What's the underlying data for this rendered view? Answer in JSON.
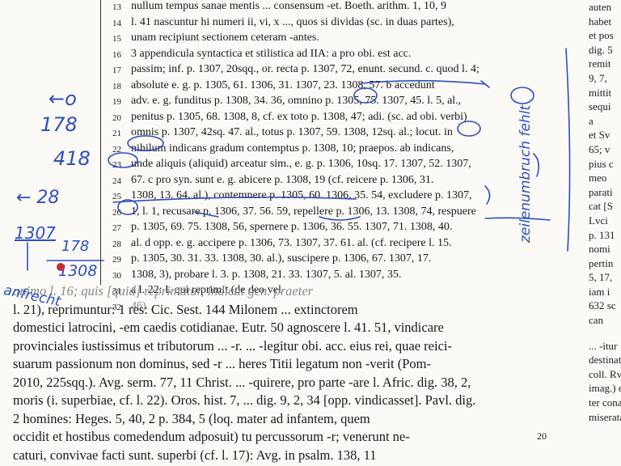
{
  "upper_lines": [
    {
      "num": "13",
      "text": "nullum tempus sanae mentis ... consensum -et. Boeth. arithm. 1, 10, 9"
    },
    {
      "num": "14",
      "text": "l. 41 nascuntur hi numeri ii, vi, x ..., quos si dividas (sc. in duas partes),"
    },
    {
      "num": "15",
      "text": "unam recipiunt sectionem ceteram -antes."
    },
    {
      "num": "16",
      "text": "3 appendicula syntactica et stilistica ad IIA:    a pro obi. est acc."
    },
    {
      "num": "17",
      "text": "passim; inf. p. 1307, 20sqq., or. recta p. 1307, 72, enunt. secund. c. quod l. 4;"
    },
    {
      "num": "18",
      "text": "absolute e. g. p. 1305, 61. 1306, 31. 1307, 23. 1308, 57.    b accedunt"
    },
    {
      "num": "19",
      "text": "adv. e. g. funditus p. 1308, 34. 36, omnino p. 1305, 75. 1307, 45. l. 5, al.,"
    },
    {
      "num": "20",
      "text": "penitus p. 1305, 68. 1308, 8, cf. ex toto p. 1308, 47; adi. (sc. ad obi. verbi)"
    },
    {
      "num": "21",
      "text": "omnis p. 1307, 42sq. 47. al., totus p. 1307, 59. 1308, 12sq. al.; locut. in"
    },
    {
      "num": "22",
      "text": "nihilum indicans gradum contemptus p. 1308, 10; praepos. ab indicans,"
    },
    {
      "num": "23",
      "text": "unde aliquis (aliquid) arceatur sim., e. g. p. 1306, 10sq. 17. 1307, 52. 1307,"
    },
    {
      "num": "24",
      "text": "67.    c pro syn. sunt e. g. abicere p. 1308, 19 (cf. reicere p. 1306, 31."
    },
    {
      "num": "25",
      "text": "1308, 13. 64. al.), contemnere p. 1305, 60. 1306, 35. 54, excludere p. 1307,"
    },
    {
      "num": "26",
      "text": "1, l. 1, recusare p. 1306, 37. 56. 59, repellere p. 1306, 13. 1308, 74, respuere"
    },
    {
      "num": "27",
      "text": "p. 1305, 69. 75. 1308, 56, spernere p. 1306, 36. 55. 1307, 71. 1308, 40."
    },
    {
      "num": "28",
      "text": "al.    d opp. e. g. accipere p. 1306, 73. 1307, 37. 61. al. (cf. recipere l. 15."
    },
    {
      "num": "29",
      "text": "p. 1305, 30. 31. 33. 1308, 30. al.), suscipere p. 1306, 67. 1307, 17."
    },
    {
      "num": "30",
      "text": "1308, 3), probare l. 3. p. 1308, 21. 33. 1307, 5. al. 1307, 35."
    },
    {
      "num": "31",
      "text": "a l. 22:    I. qui reprimit (de deo vel"
    },
    {
      "num": "32",
      "text": "46)"
    }
  ],
  "lower_lines": [
    "animo l. 16; quis [quid] reprimatur, indicat gen. praeter",
    "l. 21), reprimuntur:    1 res:  Cic. Sest. 144 Milonem ... extinctorem",
    "domestici latrocini, -em caedis cotidianae. Eutr. 50 agnoscere l. 41. 51, vindicare",
    "provinciales iustissimus et tributorum ... -r. ... -legitur obi. acc. eius rei, quae reici-",
    "suarum passionum non dominus, sed -r ... heres Titii legatum non -verit (Pom-",
    "2010, 225sqq.). Avg. serm. 77, 11 Christ. ... -quirere, pro parte -are l. Afric. dig. 38, 2,",
    "moris (i. superbiae, cf. l. 22). Oros. hist. 7, ... dig. 9, 2, 34 [opp. vindicasset]. Pavl. dig.",
    "2 homines:   Heges. 5, 40, 2 p. 384, 5 (loq. mater ad infantem, quem",
    "occidit et hostibus comedendum adposuit) tu percussorum -r; venerunt ne-",
    "caturi, convivae facti sunt.        superbi (cf. l. 17): Avg. in psalm. 138, 11"
  ],
  "right_column": [
    "auten",
    "habet",
    "et pos",
    "dig. 5",
    "remit",
    "9, 7,",
    "mittit",
    "sequi",
    "a",
    "et Sv",
    "65; v",
    "pius c",
    "meo",
    "parati",
    "cat [S",
    "Lvci",
    "p. 131",
    "nomi",
    "pertin",
    "5, 17,",
    "iam i",
    "632 sc",
    "can",
    "... -itur",
    "destinat",
    "coll. Rvi",
    "imag.) e",
    "ter cona",
    "miserata"
  ],
  "page_number": "20",
  "handwriting": {
    "margin_notes": [
      "←o",
      "178",
      "418",
      "← 28",
      "1307",
      "178",
      "1308",
      "anfrecht"
    ],
    "vertical_note": "zeilenumbruch fehlt",
    "ink_color": "#2c4fc4"
  }
}
